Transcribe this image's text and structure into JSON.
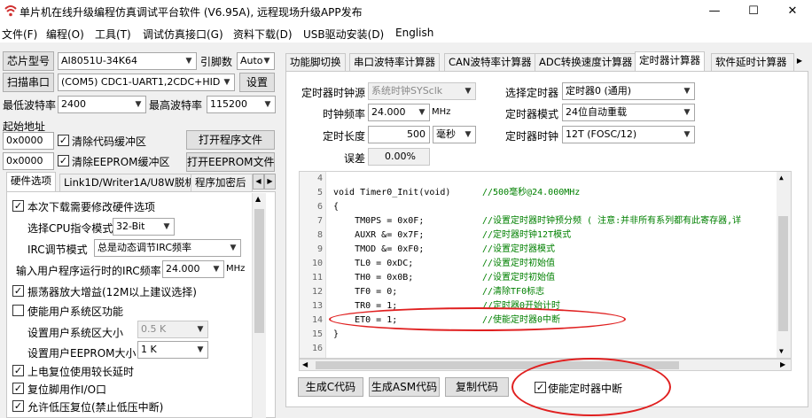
{
  "window": {
    "title": "单片机在线升级编程仿真调试平台软件 (V6.95A), 远程现场升级APP发布",
    "minimize": "—",
    "maximize": "☐",
    "close": "✕"
  },
  "menu": [
    "文件(F)",
    "编程(O)",
    "工具(T)",
    "调试仿真接口(G)",
    "资料下载(D)",
    "USB驱动安装(D)",
    "English"
  ],
  "left": {
    "chip_label": "芯片型号",
    "chip_value": "AI8051U-34K64",
    "pin_label": "引脚数",
    "pin_value": "Auto",
    "scan_label": "扫描串口",
    "port_value": "(COM5) CDC1-UART1,2CDC+HID",
    "settings_label": "设置",
    "min_baud_label": "最低波特率",
    "min_baud_value": "2400",
    "max_baud_label": "最高波特率",
    "max_baud_value": "115200",
    "start_addr_label": "起始地址",
    "addr1_value": "0x0000",
    "clear_code_label": "清除代码缓冲区",
    "open_prog_label": "打开程序文件",
    "addr2_value": "0x0000",
    "clear_eeprom_label": "清除EEPROM缓冲区",
    "open_eeprom_label": "打开EEPROM文件",
    "tabs": [
      "硬件选项",
      "Link1D/Writer1A/U8W脱机",
      "程序加密后"
    ],
    "options": {
      "reset_option": "本次下载需要修改硬件选项",
      "cpu_mode_label": "选择CPU指令模式",
      "cpu_mode_value": "32-Bit",
      "irc_mode_label": "IRC调节模式",
      "irc_mode_value": "总是动态调节IRC频率",
      "irc_freq_label": "输入用户程序运行时的IRC频率",
      "irc_freq_value": "24.000",
      "irc_freq_unit": "MHz",
      "osc_gain": "振荡器放大增益(12M以上建议选择)",
      "user_sys_area": "使能用户系统区功能",
      "sys_size_label": "设置用户系统区大小",
      "sys_size_value": "0.5 K",
      "eeprom_size_label": "设置用户EEPROM大小",
      "eeprom_size_value": "1  K",
      "por_delay": "上电复位使用较长延时",
      "reset_pin_io": "复位脚用作I/O口",
      "lvd_reset": "允许低压复位(禁止低压中断)"
    }
  },
  "right": {
    "tabs": [
      "功能脚切换",
      "串口波特率计算器",
      "CAN波特率计算器",
      "ADC转换速度计算器",
      "定时器计算器",
      "软件延时计算器"
    ],
    "clock_src_label": "定时器时钟源",
    "clock_src_value": "系统时钟SYSclk",
    "clock_freq_label": "时钟频率",
    "clock_freq_value": "24.000",
    "clock_freq_unit": "MHz",
    "length_label": "定时长度",
    "length_value": "500",
    "length_unit": "毫秒",
    "error_label": "误差",
    "error_value": "0.00%",
    "timer_sel_label": "选择定时器",
    "timer_sel_value": "定时器0 (通用)",
    "timer_mode_label": "定时器模式",
    "timer_mode_value": "24位自动重载",
    "timer_clk_label": "定时器时钟",
    "timer_clk_value": "12T (FOSC/12)",
    "code_lines": [
      {
        "n": "4",
        "c": "",
        "m": ""
      },
      {
        "n": "5",
        "c": "void Timer0_Init(void)",
        "m": "//500毫秒@24.000MHz"
      },
      {
        "n": "6",
        "c": "{",
        "m": ""
      },
      {
        "n": "7",
        "c": "    TM0PS = 0x0F;",
        "m": "//设置定时器时钟预分频 ( 注意:并非所有系列都有此寄存器,详"
      },
      {
        "n": "8",
        "c": "    AUXR &= 0x7F;",
        "m": "//定时器时钟12T模式"
      },
      {
        "n": "9",
        "c": "    TMOD &= 0xF0;",
        "m": "//设置定时器模式"
      },
      {
        "n": "10",
        "c": "    TL0 = 0xDC;",
        "m": "//设置定时初始值"
      },
      {
        "n": "11",
        "c": "    TH0 = 0x0B;",
        "m": "//设置定时初始值"
      },
      {
        "n": "12",
        "c": "    TF0 = 0;",
        "m": "//清除TF0标志"
      },
      {
        "n": "13",
        "c": "    TR0 = 1;",
        "m": "//定时器0开始计时"
      },
      {
        "n": "14",
        "c": "    ET0 = 1;",
        "m": "//使能定时器0中断"
      },
      {
        "n": "15",
        "c": "}",
        "m": ""
      },
      {
        "n": "16",
        "c": "",
        "m": ""
      }
    ],
    "gen_c_label": "生成C代码",
    "gen_asm_label": "生成ASM代码",
    "copy_code_label": "复制代码",
    "enable_int_label": "使能定时器中断"
  },
  "colors": {
    "annotation": "#e02020",
    "comment": "#008000",
    "window_bg": "#f0f0f0"
  }
}
